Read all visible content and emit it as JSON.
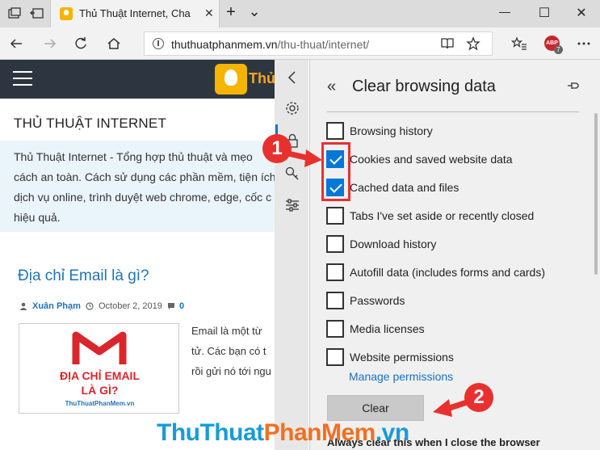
{
  "browser": {
    "tab_title": "Thủ Thuật Internet, Cha",
    "tab_close": "✕",
    "new_tab": "+",
    "tab_menu": "⌄",
    "window_minimize": "—",
    "window_maximize": "☐",
    "window_close": "✕",
    "url_domain": "thuthuatphanmem.vn",
    "url_path": "/thu-thuat/internet/",
    "abp_label": "ABP",
    "abp_count": "7"
  },
  "page": {
    "logo_text": "Thủ",
    "category_title": "THỦ THUẬT INTERNET",
    "intro_lines": [
      "Thủ Thuật Internet - Tổng hợp thủ thuật và mẹo",
      "cách an toàn. Cách sử dụng các phần mềm, tiện ích",
      "dịch vụ online, trình duyệt web chrome, edge, cốc c",
      "hiệu quả."
    ],
    "post_title": "Địa chỉ Email là gì?",
    "post_author": "Xuân Phạm",
    "post_date": "October 2, 2019",
    "post_comments": "0",
    "thumb_line1": "ĐỊA CHỈ EMAIL",
    "thumb_line2": "LÀ GÌ?",
    "thumb_caption": "ThuThuatPhanMem.vn",
    "excerpt_lines": [
      "Email là một từ",
      "tử. Các bạn có t",
      "rồi gửi nó tới ngu"
    ]
  },
  "panel": {
    "back_glyph": "«",
    "title": "Clear browsing data",
    "options": [
      {
        "label": "Browsing history",
        "checked": false
      },
      {
        "label": "Cookies and saved website data",
        "checked": true
      },
      {
        "label": "Cached data and files",
        "checked": true
      },
      {
        "label": "Tabs I've set aside or recently closed",
        "checked": false
      },
      {
        "label": "Download history",
        "checked": false
      },
      {
        "label": "Autofill data (includes forms and cards)",
        "checked": false
      },
      {
        "label": "Passwords",
        "checked": false
      },
      {
        "label": "Media licenses",
        "checked": false
      },
      {
        "label": "Website permissions",
        "checked": false
      }
    ],
    "manage_link": "Manage permissions",
    "clear_button": "Clear",
    "always_clear": "Always clear this when I close the browser"
  },
  "annotations": {
    "step1": "1",
    "step2": "2",
    "accent_color": "#e8312f"
  },
  "watermark": {
    "part1": "Thu",
    "part2": "Thuat",
    "part3": "PhanMem",
    "part4": ".vn"
  },
  "colors": {
    "accent_blue": "#0078d7",
    "header_dark": "#2d3640",
    "logo_yellow": "#f5b400",
    "link_blue": "#1f73b7"
  }
}
